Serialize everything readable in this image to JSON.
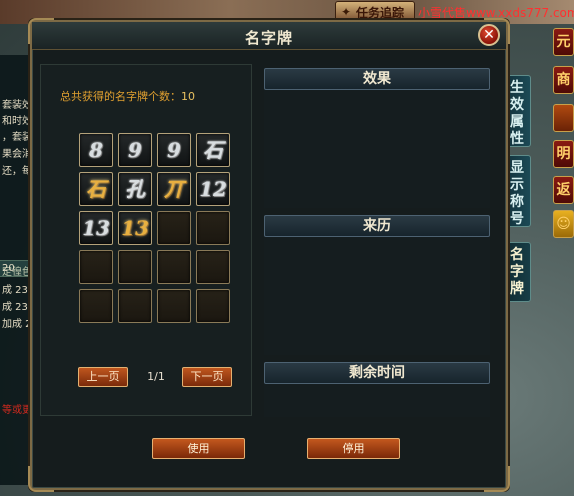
{
  "window": {
    "title": "名字牌",
    "close_symbol": "✕"
  },
  "left": {
    "count_label": "总共获得的名字牌个数：",
    "count_value": "10",
    "slots": [
      {
        "glyph": "8",
        "style": "silver"
      },
      {
        "glyph": "9",
        "style": "silver"
      },
      {
        "glyph": "9",
        "style": "silver"
      },
      {
        "glyph": "石",
        "style": "silver"
      },
      {
        "glyph": "石",
        "style": "gold"
      },
      {
        "glyph": "孔",
        "style": "silver"
      },
      {
        "glyph": "丌",
        "style": "gold"
      },
      {
        "glyph": "12",
        "style": "silver"
      },
      {
        "glyph": "13",
        "style": "silver"
      },
      {
        "glyph": "13",
        "style": "gold"
      },
      {
        "glyph": "",
        "style": "empty"
      },
      {
        "glyph": "",
        "style": "empty"
      },
      {
        "glyph": "",
        "style": "empty"
      },
      {
        "glyph": "",
        "style": "empty"
      },
      {
        "glyph": "",
        "style": "empty"
      },
      {
        "glyph": "",
        "style": "empty"
      },
      {
        "glyph": "",
        "style": "empty"
      },
      {
        "glyph": "",
        "style": "empty"
      },
      {
        "glyph": "",
        "style": "empty"
      },
      {
        "glyph": "",
        "style": "empty"
      }
    ],
    "pager": {
      "prev_label": "上一页",
      "page": "1/1",
      "next_label": "下一页"
    }
  },
  "right": {
    "effect_label": "效果",
    "source_label": "来历",
    "time_label": "剩余时间"
  },
  "actions": {
    "use_label": "使用",
    "stop_label": "停用"
  },
  "background": {
    "logo_text": "任务追踪",
    "watermark": "小雪代售www.xxds777.com",
    "tabs": [
      {
        "label": "生效属性"
      },
      {
        "label": "显示称号"
      },
      {
        "label": "名字牌"
      }
    ],
    "icons": [
      "元",
      "商",
      "明",
      "返",
      "☺"
    ],
    "left_lines": [
      "套装效",
      "和时效",
      "，套装",
      "果会消",
      "还，每",
      "定徨色套装",
      "20",
      "成 23%",
      "成 23%",
      "加成 27%",
      "等或更"
    ]
  },
  "colors": {
    "accent_gold": "#e0a030",
    "button_orange": "#c4581e",
    "panel_bg": "#151c1d"
  }
}
